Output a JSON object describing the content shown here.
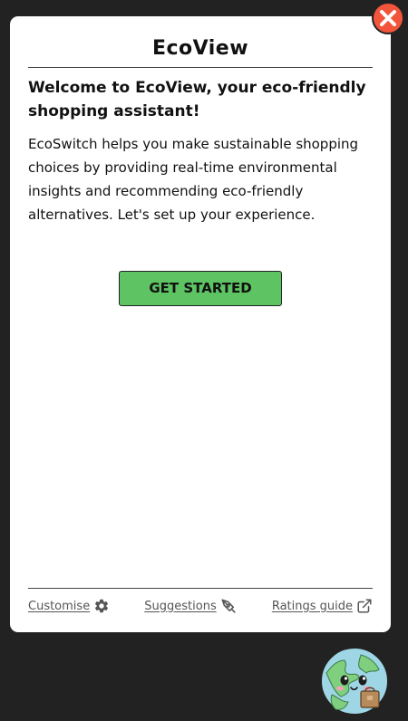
{
  "header": {
    "brand": "EcoView"
  },
  "main": {
    "welcome_heading": "Welcome to EcoView, your eco-friendly shopping assistant!",
    "intro_text": "EcoSwitch helps you make sustainable shopping choices by providing real-time environmental insights and recommending eco-friendly alternatives. Let's set up your experience.",
    "cta_label": "GET STARTED"
  },
  "footer": {
    "customise_label": "Customise",
    "customise_icon": "gear-icon",
    "suggestions_label": "Suggestions",
    "suggestions_icon": "pen-nib-icon",
    "ratings_label": "Ratings guide",
    "ratings_icon": "external-link-icon"
  },
  "controls": {
    "close_icon": "close-icon",
    "mascot_icon": "earth-mascot-icon"
  },
  "colors": {
    "background": "#222222",
    "panel": "#ffffff",
    "accent_green": "#5ec463",
    "close_red": "#f2553b",
    "link_gray": "#555555"
  }
}
